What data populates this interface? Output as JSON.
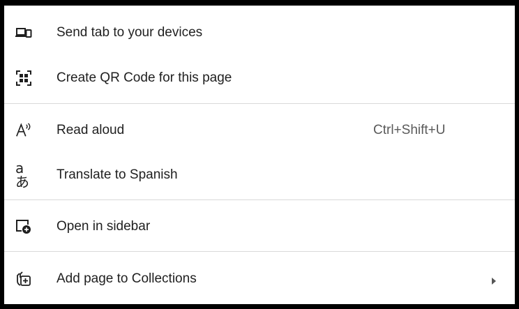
{
  "menu": {
    "items": [
      {
        "label": "Send tab to your devices",
        "icon": "devices-icon"
      },
      {
        "label": "Create QR Code for this page",
        "icon": "qr-code-icon"
      },
      {
        "label": "Read aloud",
        "icon": "read-aloud-icon",
        "shortcut": "Ctrl+Shift+U"
      },
      {
        "label": "Translate to Spanish",
        "icon": "translate-icon",
        "icon_text": "aあ"
      },
      {
        "label": "Open in sidebar",
        "icon": "sidebar-open-icon"
      },
      {
        "label": "Add page to Collections",
        "icon": "collections-add-icon",
        "has_submenu": true
      }
    ]
  },
  "colors": {
    "text": "#1f1f1f",
    "shortcut_text": "#5a5a5a",
    "separator": "#d9d9d9",
    "background": "#ffffff",
    "frame": "#000000"
  }
}
